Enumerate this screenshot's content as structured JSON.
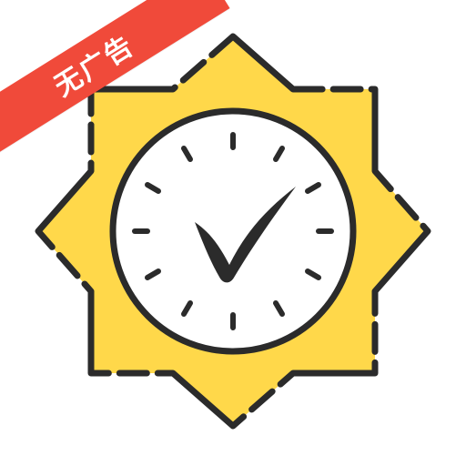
{
  "ribbon": {
    "label": "无广告"
  },
  "icons": {
    "main": "sun-clock-check-icon",
    "ribbon": "no-ads-ribbon"
  },
  "colors": {
    "background": "#ffffff",
    "sun": "#FFD84A",
    "outline": "#2B2B2B",
    "face": "#FFFFFF",
    "ribbon": "#F04A3A",
    "ribbon_text": "#FFFFFF"
  }
}
